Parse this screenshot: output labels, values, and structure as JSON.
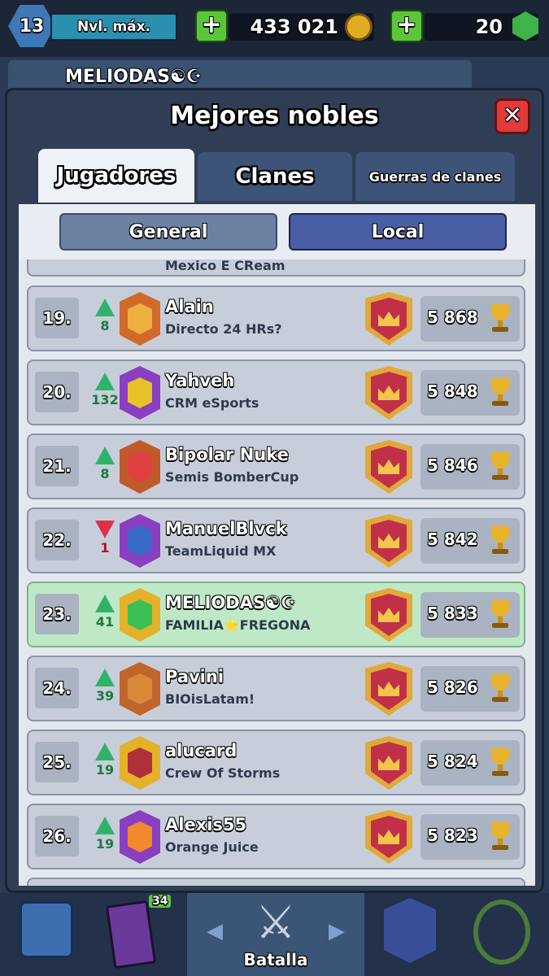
{
  "status": {
    "level": "13",
    "level_label": "Nvl. máx.",
    "gold": "433 021",
    "gems": "20",
    "plus": "+"
  },
  "behind": {
    "player_name": "MELIODAS☯☪"
  },
  "modal": {
    "title": "Mejores nobles",
    "close": "✕",
    "tabs": [
      "Jugadores",
      "Clanes",
      "Guerras de clanes"
    ],
    "subtabs": [
      "General",
      "Local"
    ],
    "partial_top_clan": "Mexico E CReam"
  },
  "players": [
    {
      "rank": "19.",
      "dir": "up",
      "change": "8",
      "name": "Alain",
      "clan": "Directo 24 HRs?",
      "trophies": "5 868",
      "badge": "#d06a2a",
      "inner": "#f0b040"
    },
    {
      "rank": "20.",
      "dir": "up",
      "change": "132",
      "name": "Yahveh",
      "clan": "CRM eSports",
      "trophies": "5 848",
      "badge": "#8a3ec0",
      "inner": "#e8c22a"
    },
    {
      "rank": "21.",
      "dir": "up",
      "change": "8",
      "name": "Bipolar Nuke",
      "clan": "Semis BomberCup",
      "trophies": "5 846",
      "badge": "#c05a2a",
      "inner": "#e04040"
    },
    {
      "rank": "22.",
      "dir": "down",
      "change": "1",
      "name": "ManuelBlvck",
      "clan": "TeamLiquid MX",
      "trophies": "5 842",
      "badge": "#8a3ec0",
      "inner": "#3a6ac8"
    },
    {
      "rank": "23.",
      "dir": "up",
      "change": "41",
      "name": "MELIODAS☯☪",
      "clan": "FAMILIA⭐FREGONA",
      "trophies": "5 833",
      "badge": "#e3b22a",
      "inner": "#3ac050",
      "me": true
    },
    {
      "rank": "24.",
      "dir": "up",
      "change": "39",
      "name": "Pavini",
      "clan": "BIOisLatam!",
      "trophies": "5 826",
      "badge": "#c0662a",
      "inner": "#d8893a"
    },
    {
      "rank": "25.",
      "dir": "up",
      "change": "19",
      "name": "alucard",
      "clan": "Crew Of Storms",
      "trophies": "5 824",
      "badge": "#e3b22a",
      "inner": "#b0303a"
    },
    {
      "rank": "26.",
      "dir": "up",
      "change": "19",
      "name": "Alexis55",
      "clan": "Orange Juice",
      "trophies": "5 823",
      "badge": "#8a3ec0",
      "inner": "#f08a2a"
    }
  ],
  "nav": {
    "battle_label": "Batalla",
    "cards_count": "34",
    "items": [
      "shop-chest-icon",
      "cards-icon",
      "battle-swords-icon",
      "clan-icon",
      "tournament-icon"
    ]
  }
}
